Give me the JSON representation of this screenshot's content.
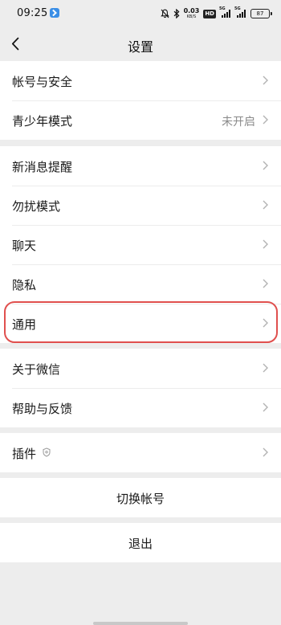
{
  "status_bar": {
    "time": "09:25",
    "app_icon": "check-app-icon",
    "net_speed_value": "0.03",
    "net_speed_unit": "KB/S",
    "hd_label": "HD",
    "signal_1_gen": "5G",
    "signal_2_gen": "5G",
    "battery_level": "87",
    "icons": [
      "mute-bell-icon",
      "bluetooth-icon",
      "signal-icon",
      "battery-icon"
    ]
  },
  "nav": {
    "title": "设置",
    "back_icon": "chevron-left-icon"
  },
  "groups": [
    {
      "items": [
        {
          "label": "帐号与安全",
          "value": ""
        },
        {
          "label": "青少年模式",
          "value": "未开启"
        }
      ]
    },
    {
      "items": [
        {
          "label": "新消息提醒",
          "value": ""
        },
        {
          "label": "勿扰模式",
          "value": ""
        },
        {
          "label": "聊天",
          "value": ""
        },
        {
          "label": "隐私",
          "value": ""
        },
        {
          "label": "通用",
          "value": "",
          "highlighted": true
        }
      ]
    },
    {
      "items": [
        {
          "label": "关于微信",
          "value": ""
        },
        {
          "label": "帮助与反馈",
          "value": ""
        }
      ]
    },
    {
      "items": [
        {
          "label": "插件",
          "value": "",
          "badge_icon": "shield-icon"
        }
      ]
    }
  ],
  "actions": {
    "switch_account": "切换帐号",
    "logout": "退出"
  },
  "colors": {
    "page_background": "#ededed",
    "card_background": "#ffffff",
    "highlight_ring": "#e0504e",
    "secondary_text": "#8a8a8a"
  }
}
